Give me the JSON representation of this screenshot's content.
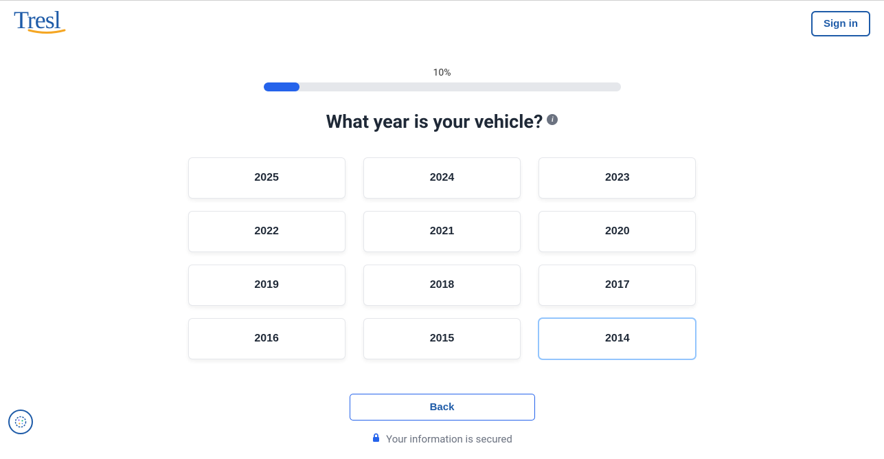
{
  "header": {
    "logo_text": "Tresl",
    "signin_label": "Sign in"
  },
  "progress": {
    "percent_label": "10%",
    "percent_value": 10
  },
  "question": {
    "title": "What year is your vehicle?"
  },
  "options": [
    {
      "label": "2025",
      "focused": false
    },
    {
      "label": "2024",
      "focused": false
    },
    {
      "label": "2023",
      "focused": false
    },
    {
      "label": "2022",
      "focused": false
    },
    {
      "label": "2021",
      "focused": false
    },
    {
      "label": "2020",
      "focused": false
    },
    {
      "label": "2019",
      "focused": false
    },
    {
      "label": "2018",
      "focused": false
    },
    {
      "label": "2017",
      "focused": false
    },
    {
      "label": "2016",
      "focused": false
    },
    {
      "label": "2015",
      "focused": false
    },
    {
      "label": "2014",
      "focused": true
    }
  ],
  "controls": {
    "back_label": "Back"
  },
  "footer": {
    "secured_text": "Your information is secured"
  }
}
